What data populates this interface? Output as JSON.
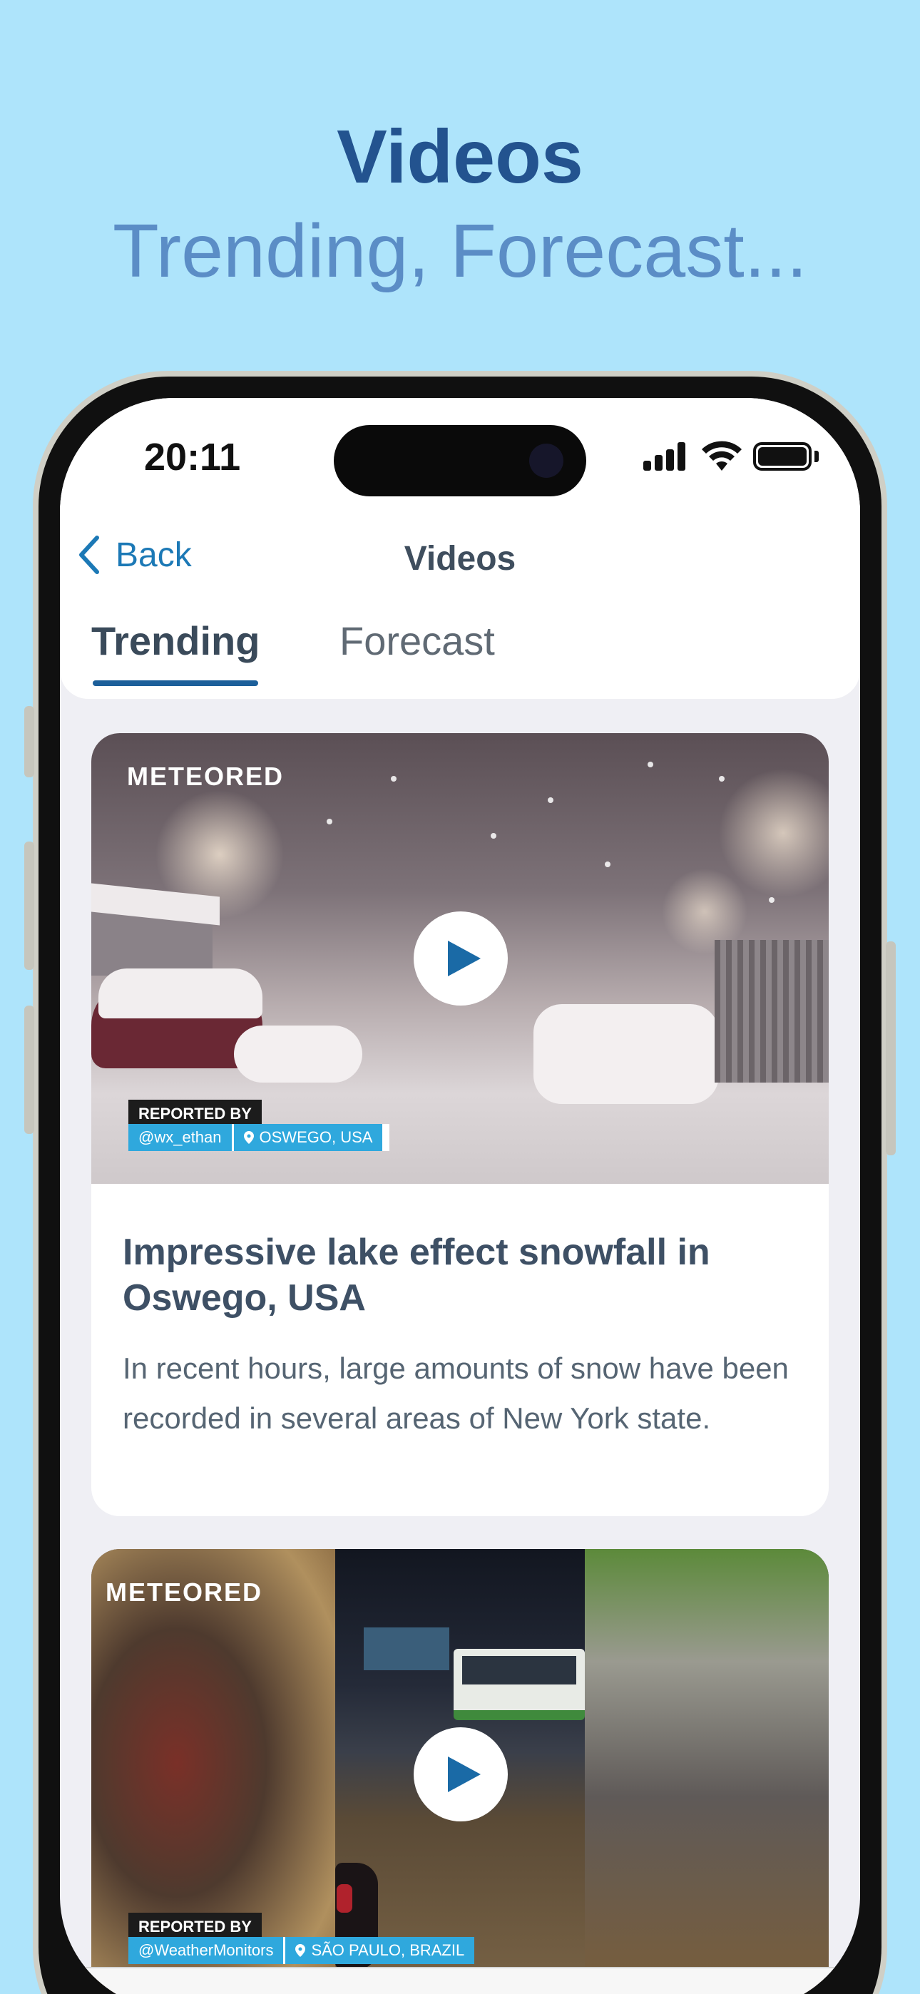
{
  "promo": {
    "title": "Videos",
    "subtitle": "Trending, Forecast..."
  },
  "status_bar": {
    "time": "20:11"
  },
  "nav": {
    "back_label": "Back",
    "title": "Videos"
  },
  "tabs": [
    {
      "label": "Trending",
      "selected": true
    },
    {
      "label": "Forecast",
      "selected": false
    }
  ],
  "colors": {
    "background": "#aee4fb",
    "accent": "#1c79b6",
    "tab_underline": "#1c5f9a",
    "tag_blue": "#2fa8dd"
  },
  "videos": [
    {
      "brand": "METEORED",
      "reported_by_label": "REPORTED BY",
      "reporter": "@wx_ethan",
      "location": "OSWEGO, USA",
      "title": "Impressive lake effect snowfall in Oswego, USA",
      "description": "In recent hours, large amounts of snow have been recorded in several areas of New York state."
    },
    {
      "brand": "METEORED",
      "reported_by_label": "REPORTED BY",
      "reporter": "@WeatherMonitors",
      "location": "SÃO PAULO, BRAZIL"
    }
  ]
}
